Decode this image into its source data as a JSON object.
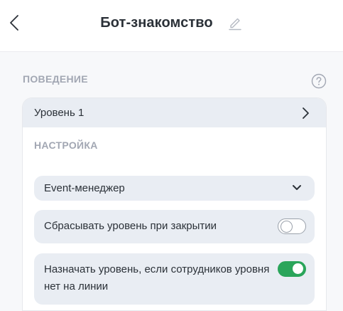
{
  "header": {
    "title": "Бот-знакомство"
  },
  "behavior": {
    "section_label": "ПОВЕДЕНИЕ",
    "level": {
      "label": "Уровень 1"
    },
    "settings": {
      "label": "НАСТРОЙКА",
      "role_select": {
        "value": "Event-менеджер"
      },
      "reset_on_close": {
        "label": "Сбрасывать уровень при закрытии",
        "enabled": false
      },
      "assign_if_no_staff": {
        "label": "Назначать уровень, если сотрудников уровня нет на линии",
        "enabled": true
      }
    }
  },
  "colors": {
    "accent_green": "#2aa55a",
    "muted_text": "#a2a7b3",
    "row_bg": "#e9edf3"
  }
}
